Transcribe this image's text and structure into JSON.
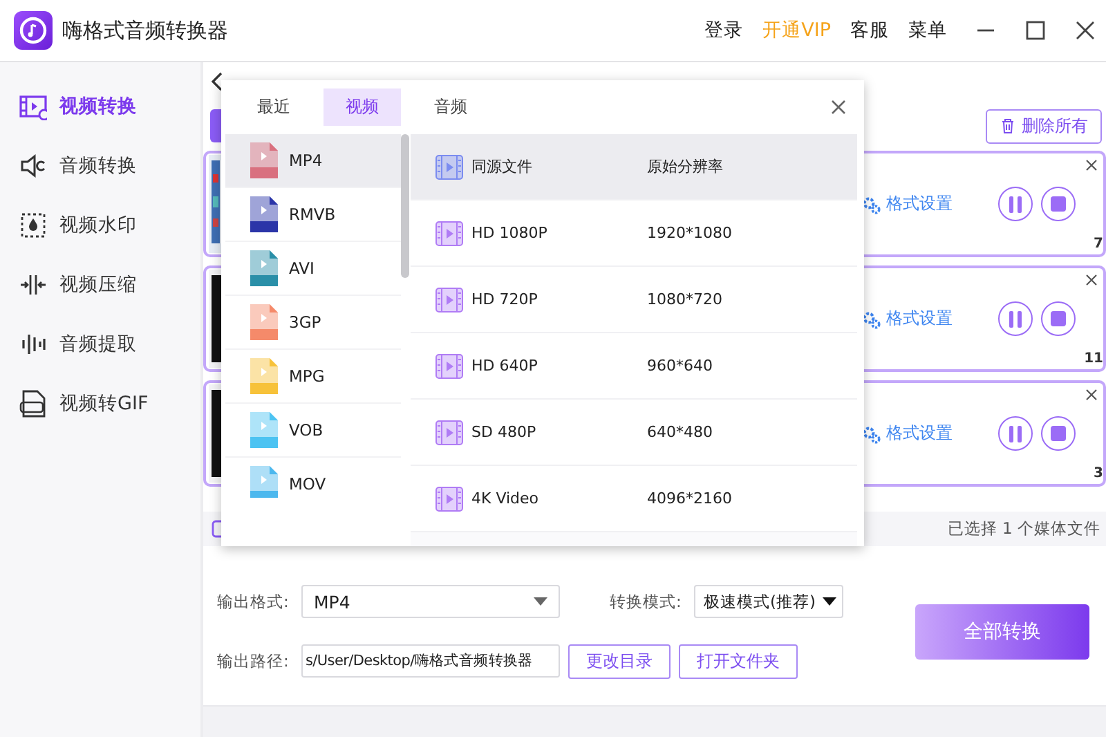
{
  "window": {
    "title": "嗨格式音频转换器"
  },
  "header_links": [
    {
      "label": "登录",
      "kind": "plain"
    },
    {
      "label": "开通VIP",
      "kind": "vip"
    },
    {
      "label": "客服",
      "kind": "plain"
    },
    {
      "label": "菜单",
      "kind": "plain"
    }
  ],
  "sidebar": {
    "items": [
      {
        "label": "视频转换",
        "selected": true
      },
      {
        "label": "音频转换",
        "selected": false
      },
      {
        "label": "视频水印",
        "selected": false
      },
      {
        "label": "视频压缩",
        "selected": false
      },
      {
        "label": "音频提取",
        "selected": false
      },
      {
        "label": "视频转GIF",
        "selected": false
      }
    ]
  },
  "toolbar": {
    "delete_all": "删除所有"
  },
  "files": [
    {
      "settings": "格式设置",
      "progress": "7"
    },
    {
      "settings": "格式设置",
      "progress": "11"
    },
    {
      "settings": "格式设置",
      "progress": "3"
    }
  ],
  "summary": "已选择 1 个媒体文件",
  "format_popup": {
    "tabs": [
      {
        "label": "最近",
        "selected": false
      },
      {
        "label": "视频",
        "selected": true
      },
      {
        "label": "音频",
        "selected": false
      }
    ],
    "formats": [
      {
        "label": "MP4",
        "color": "#d9707f",
        "selected": true
      },
      {
        "label": "RMVB",
        "color": "#2b35a8",
        "selected": false
      },
      {
        "label": "AVI",
        "color": "#2a8fa8",
        "selected": false
      },
      {
        "label": "3GP",
        "color": "#f58a6a",
        "selected": false
      },
      {
        "label": "MPG",
        "color": "#f7c23a",
        "selected": false
      },
      {
        "label": "VOB",
        "color": "#4cc3f2",
        "selected": false
      },
      {
        "label": "MOV",
        "color": "#4cb8ee",
        "selected": false
      }
    ],
    "presets": [
      {
        "name": "同源文件",
        "resolution": "原始分辨率",
        "selected": true
      },
      {
        "name": "HD 1080P",
        "resolution": "1920*1080",
        "selected": false
      },
      {
        "name": "HD 720P",
        "resolution": "1080*720",
        "selected": false
      },
      {
        "name": "HD 640P",
        "resolution": "960*640",
        "selected": false
      },
      {
        "name": "SD 480P",
        "resolution": "640*480",
        "selected": false
      },
      {
        "name": "4K Video",
        "resolution": "4096*2160",
        "selected": false
      }
    ]
  },
  "settings": {
    "format_label": "输出格式:",
    "format_value": "MP4",
    "mode_label": "转换模式:",
    "mode_value": "极速模式(推荐)",
    "path_label": "输出路径:",
    "path_value": "s/User/Desktop/嗨格式音频转换器",
    "change_dir": "更改目录",
    "open_folder": "打开文件夹",
    "convert_all": "全部转换"
  }
}
